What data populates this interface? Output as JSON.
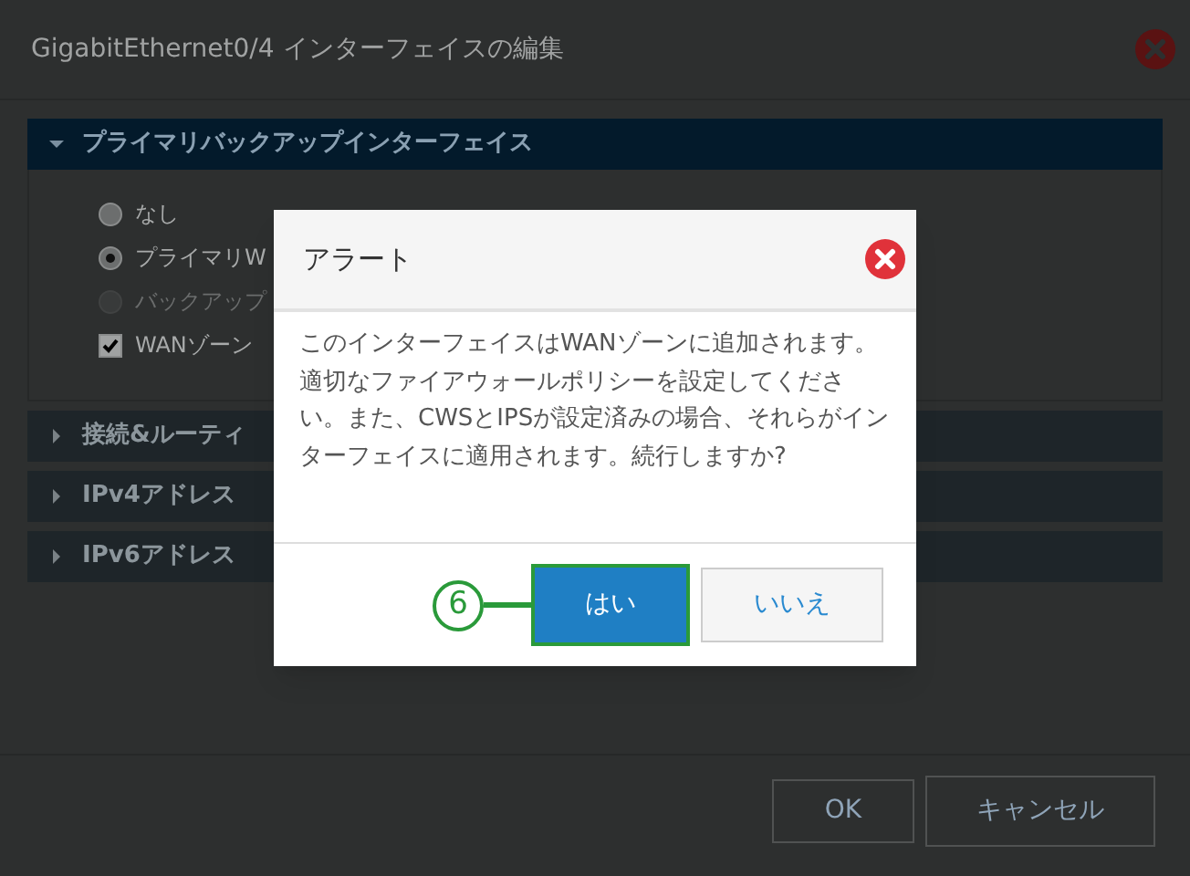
{
  "window": {
    "title": "GigabitEthernet0/4 インターフェイスの編集"
  },
  "sections": [
    {
      "title": "プライマリバックアップインターフェイス",
      "expanded": true,
      "options": [
        {
          "kind": "radio",
          "label": "なし",
          "selected": false,
          "disabled": false
        },
        {
          "kind": "radio",
          "label": "プライマリW",
          "selected": true,
          "disabled": false
        },
        {
          "kind": "radio",
          "label": "バックアップ",
          "selected": false,
          "disabled": true
        },
        {
          "kind": "checkbox",
          "label": "WANゾーン",
          "checked": true
        }
      ]
    },
    {
      "title": "接続&ルーティ",
      "expanded": false
    },
    {
      "title": "IPv4アドレス",
      "expanded": false
    },
    {
      "title": "IPv6アドレス",
      "expanded": false
    }
  ],
  "footer_buttons": [
    "OK",
    "キャンセル"
  ],
  "alert": {
    "title": "アラート",
    "message": "このインターフェイスはWANゾーンに追加されます。適切なファイアウォールポリシーを設定してください。また、CWSとIPSが設定済みの場合、それらがインターフェイスに適用されます。続行しますか?",
    "buttons": [
      {
        "label": "はい",
        "kind": "primary"
      },
      {
        "label": "いいえ",
        "kind": "secondary"
      }
    ],
    "callout": "6"
  }
}
